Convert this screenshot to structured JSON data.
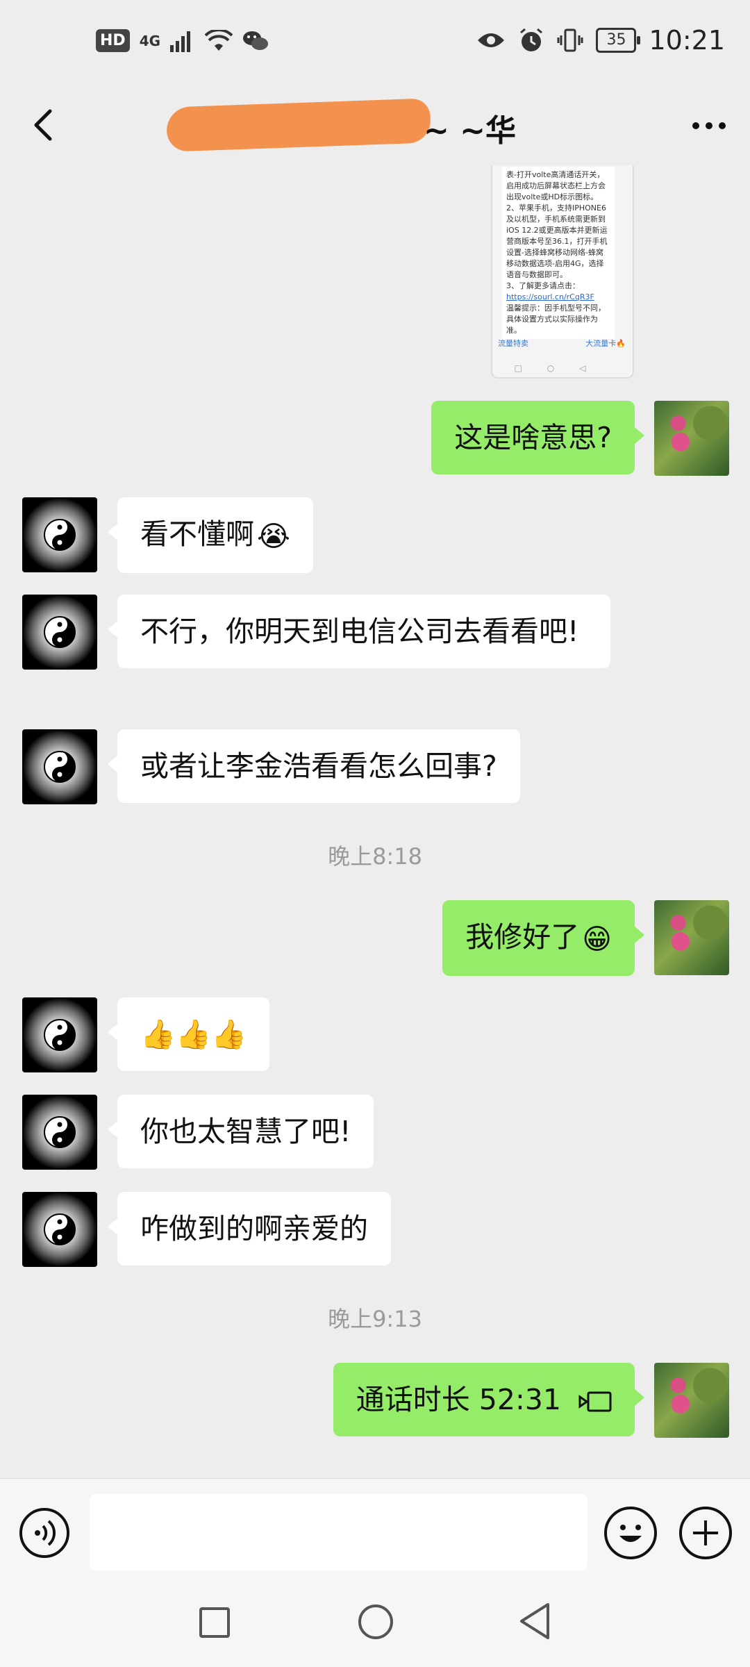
{
  "status_bar": {
    "hd": "HD",
    "network": "4G",
    "battery": "35",
    "time": "10:21",
    "icons": [
      "hd-badge",
      "signal-icon",
      "wifi-icon",
      "wechat-icon",
      "eye-icon",
      "alarm-icon",
      "vibrate-icon",
      "battery-icon"
    ]
  },
  "header": {
    "title_suffix": "~ ~华",
    "back_icon": "back-arrow-icon",
    "more_icon": "more-icon"
  },
  "image_message": {
    "lines": [
      "表-打开volte高清通话开关，",
      "启用成功后屏幕状态栏上方会",
      "出现volte或HD标示图标。",
      "2、苹果手机，支持IPHONE6",
      "及以机型，手机系统需更新到",
      "iOS 12.2或更高版本并更新运",
      "营商版本号至36.1，打开手机",
      "设置-选择蜂窝移动网络-蜂窝",
      "移动数据选项-启用4G，选择",
      "语音与数据即可。",
      "3、了解更多请点击："
    ],
    "link": "https://sourl.cn/rCqR3F",
    "tail_lines": [
      "温馨提示：因手机型号不同，",
      "具体设置方式以实际操作为",
      "准。"
    ],
    "bottom_left": "流量特卖",
    "bottom_right": "大流量卡🔥"
  },
  "messages": [
    {
      "side": "right",
      "text": "这是啥意思?"
    },
    {
      "side": "left",
      "text": "看不懂啊",
      "emoji": "😭"
    },
    {
      "side": "left",
      "text": "不行，你明天到电信公司去看看吧!"
    },
    {
      "side": "left",
      "text": "或者让李金浩看看怎么回事?"
    },
    {
      "side": "right",
      "text": "我修好了",
      "emoji": "😁"
    },
    {
      "side": "left",
      "text": "👍👍👍"
    },
    {
      "side": "left",
      "text": "你也太智慧了吧!"
    },
    {
      "side": "left",
      "text": "咋做到的啊亲爱的"
    },
    {
      "side": "right",
      "text": "通话时长 52:31",
      "icon": "call-icon"
    }
  ],
  "timestamps": [
    "晚上8:18",
    "晚上9:13"
  ],
  "input_bar": {
    "placeholder": "",
    "icons": [
      "voice-icon",
      "emoji-icon",
      "plus-icon"
    ]
  },
  "nav_bar": {
    "icons": [
      "recent-apps-icon",
      "home-icon",
      "back-icon"
    ]
  }
}
